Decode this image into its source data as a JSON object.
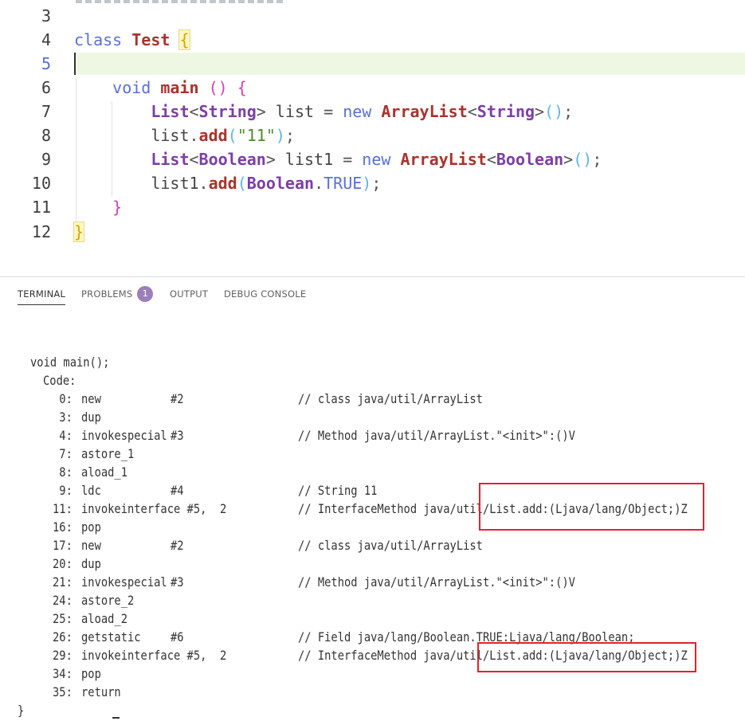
{
  "editor": {
    "current_line": "5",
    "lines": [
      {
        "num": "3",
        "code": ""
      },
      {
        "num": "4",
        "code": "class Test {"
      },
      {
        "num": "5",
        "code": ""
      },
      {
        "num": "6",
        "code": "    void main () {"
      },
      {
        "num": "7",
        "code": "        List<String> list = new ArrayList<String>();"
      },
      {
        "num": "8",
        "code": "        list.add(\"11\");"
      },
      {
        "num": "9",
        "code": "        List<Boolean> list1 = new ArrayList<Boolean>();"
      },
      {
        "num": "10",
        "code": "        list1.add(Boolean.TRUE);"
      },
      {
        "num": "11",
        "code": "    }"
      },
      {
        "num": "12",
        "code": "}"
      }
    ]
  },
  "panel": {
    "tabs": [
      {
        "label": "TERMINAL",
        "active": true
      },
      {
        "label": "PROBLEMS",
        "badge": "1"
      },
      {
        "label": "OUTPUT"
      },
      {
        "label": "DEBUG CONSOLE"
      }
    ]
  },
  "terminal": {
    "header": "void main();",
    "code_label": "Code:",
    "instructions": [
      {
        "offset": "0:",
        "op": "new",
        "arg": "#2",
        "comment": "// class java/util/ArrayList"
      },
      {
        "offset": "3:",
        "op": "dup",
        "arg": "",
        "comment": ""
      },
      {
        "offset": "4:",
        "op": "invokespecial",
        "arg": "#3",
        "comment": "// Method java/util/ArrayList.\"<init>\":()V"
      },
      {
        "offset": "7:",
        "op": "astore_1",
        "arg": "",
        "comment": ""
      },
      {
        "offset": "8:",
        "op": "aload_1",
        "arg": "",
        "comment": ""
      },
      {
        "offset": "9:",
        "op": "ldc",
        "arg": "#4",
        "comment": "// String 11"
      },
      {
        "offset": "11:",
        "op": "invokeinterface #5,  2",
        "arg": "",
        "comment": "// InterfaceMethod java/util/List.add:(Ljava/lang/Object;)Z"
      },
      {
        "offset": "16:",
        "op": "pop",
        "arg": "",
        "comment": ""
      },
      {
        "offset": "17:",
        "op": "new",
        "arg": "#2",
        "comment": "// class java/util/ArrayList"
      },
      {
        "offset": "20:",
        "op": "dup",
        "arg": "",
        "comment": ""
      },
      {
        "offset": "21:",
        "op": "invokespecial",
        "arg": "#3",
        "comment": "// Method java/util/ArrayList.\"<init>\":()V"
      },
      {
        "offset": "24:",
        "op": "astore_2",
        "arg": "",
        "comment": ""
      },
      {
        "offset": "25:",
        "op": "aload_2",
        "arg": "",
        "comment": ""
      },
      {
        "offset": "26:",
        "op": "getstatic",
        "arg": "#6",
        "comment": "// Field java/lang/Boolean.TRUE:Ljava/lang/Boolean;"
      },
      {
        "offset": "29:",
        "op": "invokeinterface #5,  2",
        "arg": "",
        "comment": "// InterfaceMethod java/util/List.add:(Ljava/lang/Object;)Z"
      },
      {
        "offset": "34:",
        "op": "pop",
        "arg": "",
        "comment": ""
      },
      {
        "offset": "35:",
        "op": "return",
        "arg": "",
        "comment": ""
      }
    ],
    "closing": "}"
  },
  "colors": {
    "keyword": "#5a6fd8",
    "type": "#7b3fa6",
    "function": "#a8322d",
    "string": "#4f8a2a",
    "current_line_bg": "#eef7e4",
    "highlight_box": "#e0242c",
    "badge": "#9b7fb8"
  }
}
